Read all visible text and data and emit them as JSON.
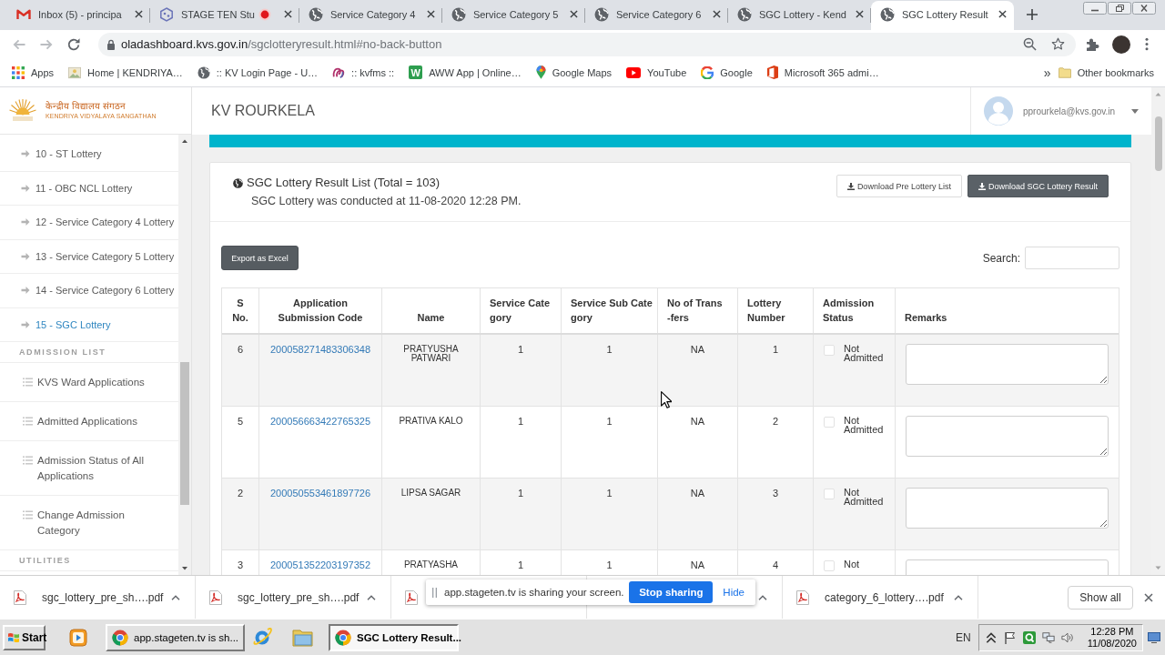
{
  "browser": {
    "tabs": [
      {
        "title": "Inbox (5) - principa",
        "kind": "mail",
        "selected": false,
        "recording": false
      },
      {
        "title": "STAGE TEN Stu",
        "kind": "hexagon",
        "selected": false,
        "recording": true
      },
      {
        "title": "Service Category 4",
        "kind": "globe",
        "selected": false,
        "recording": false
      },
      {
        "title": "Service Category 5",
        "kind": "globe",
        "selected": false,
        "recording": false
      },
      {
        "title": "Service Category 6",
        "kind": "globe",
        "selected": false,
        "recording": false
      },
      {
        "title": "SGC Lottery - Kend",
        "kind": "globe",
        "selected": false,
        "recording": false
      },
      {
        "title": "SGC Lottery Result",
        "kind": "globe",
        "selected": true,
        "recording": false
      }
    ],
    "nav": {
      "back_enabled": false,
      "forward_enabled": false
    },
    "address": {
      "domain": "oladashboard.kvs.gov.in",
      "path": "/sgclotteryresult.html#no-back-button"
    },
    "bookmarks": [
      {
        "label": "Apps",
        "kind": "grid"
      },
      {
        "label": "Home | KENDRIYA…",
        "kind": "page"
      },
      {
        "label": ":: KV Login Page - U…",
        "kind": "globe"
      },
      {
        "label": ":: kvfms ::",
        "kind": "swirl"
      },
      {
        "label": "AWW App | Online…",
        "kind": "letter",
        "letter": "W"
      },
      {
        "label": "Google Maps",
        "kind": "pin"
      },
      {
        "label": "YouTube",
        "kind": "play"
      },
      {
        "label": "Google",
        "kind": "ring"
      },
      {
        "label": "Microsoft 365 admi…",
        "kind": "office"
      }
    ],
    "more_bookmarks": "»",
    "other_bookmarks": "Other bookmarks"
  },
  "site": {
    "org_hindi": "केन्द्रीय विद्यालय संगठन",
    "org_name": "KENDRIYA VIDYALAYA SANGATHAN",
    "school": "KV ROURKELA",
    "user_email": "pprourkela@kvs.gov.in"
  },
  "sidebar": {
    "menu": [
      {
        "kind": "arrow-link",
        "label": "10 - ST Lottery",
        "selected": false
      },
      {
        "kind": "arrow-link",
        "label": "11 - OBC NCL Lottery",
        "selected": false
      },
      {
        "kind": "arrow-link",
        "label": "12 - Service Category 4 Lottery",
        "selected": false
      },
      {
        "kind": "arrow-link",
        "label": "13 - Service Category 5 Lottery",
        "selected": false
      },
      {
        "kind": "arrow-link",
        "label": "14 - Service Category 6 Lottery",
        "selected": false
      },
      {
        "kind": "arrow-link",
        "label": "15 - SGC Lottery",
        "selected": true
      },
      {
        "kind": "heading",
        "label": "ADMISSION LIST"
      },
      {
        "kind": "list-link",
        "label": "KVS Ward Applications",
        "selected": false
      },
      {
        "kind": "list-link",
        "label": "Admitted Applications",
        "selected": false
      },
      {
        "kind": "list-link",
        "label": "Admission Status of All Applications",
        "selected": false
      },
      {
        "kind": "list-link",
        "label": "Change Admission Category",
        "selected": false
      },
      {
        "kind": "heading",
        "label": "UTILITIES"
      }
    ]
  },
  "panel": {
    "title": "SGC Lottery Result List (Total = 103)",
    "subtitle": "SGC Lottery was conducted at 11-08-2020 12:28 PM.",
    "actions": [
      {
        "label": "Download Pre Lottery List",
        "primary": false
      },
      {
        "label": "Download SGC Lottery Result",
        "primary": true
      }
    ],
    "export_button": "Export as Excel",
    "search_label": "Search:"
  },
  "table": {
    "columns": [
      "S\nNo.",
      "Application\nSubmission Code",
      "Name",
      "Service Cate\ngory",
      "Service Sub Cate\ngory",
      "No of Trans\n-fers",
      "Lottery\nNumber",
      "Admission\nStatus",
      "Remarks"
    ],
    "rows": [
      {
        "s_no": "6",
        "code": "200058271483306348",
        "name": "PRATYUSHA PATWARI",
        "service_category": "1",
        "service_sub_category": "1",
        "transfers": "NA",
        "lottery_number": "1",
        "checked": false,
        "status": "Not Admitted"
      },
      {
        "s_no": "5",
        "code": "200056663422765325",
        "name": "PRATIVA KALO",
        "service_category": "1",
        "service_sub_category": "1",
        "transfers": "NA",
        "lottery_number": "2",
        "checked": false,
        "status": "Not Admitted"
      },
      {
        "s_no": "2",
        "code": "200050553461897726",
        "name": "LIPSA SAGAR",
        "service_category": "1",
        "service_sub_category": "1",
        "transfers": "NA",
        "lottery_number": "3",
        "checked": false,
        "status": "Not Admitted"
      },
      {
        "s_no": "3",
        "code": "200051352203197352",
        "name": "PRATYASHA",
        "service_category": "1",
        "service_sub_category": "1",
        "transfers": "NA",
        "lottery_number": "4",
        "checked": false,
        "status": "Not"
      }
    ]
  },
  "downloads": {
    "items": [
      {
        "kind": "full",
        "file": "sgc_lottery_pre_sh….pdf"
      },
      {
        "kind": "full",
        "file": "sgc_lottery_pre_sh….pdf"
      },
      {
        "kind": "icon"
      },
      {
        "kind": "caret"
      },
      {
        "kind": "full",
        "file": "category_6_lottery….pdf"
      }
    ],
    "show_all": "Show all"
  },
  "screen_share": {
    "message": "app.stageten.tv is sharing your screen.",
    "stop_button": "Stop sharing",
    "hide_link": "Hide"
  },
  "taskbar": {
    "start": "Start",
    "items": [
      {
        "kind": "media"
      },
      {
        "kind": "window",
        "title": "app.stageten.tv is sh...",
        "selected": false
      },
      {
        "kind": "web"
      },
      {
        "kind": "folder"
      },
      {
        "kind": "window",
        "title": "SGC Lottery Result...",
        "selected": true
      }
    ],
    "language": "EN",
    "time": "12:28 PM",
    "date": "11/08/2020"
  }
}
